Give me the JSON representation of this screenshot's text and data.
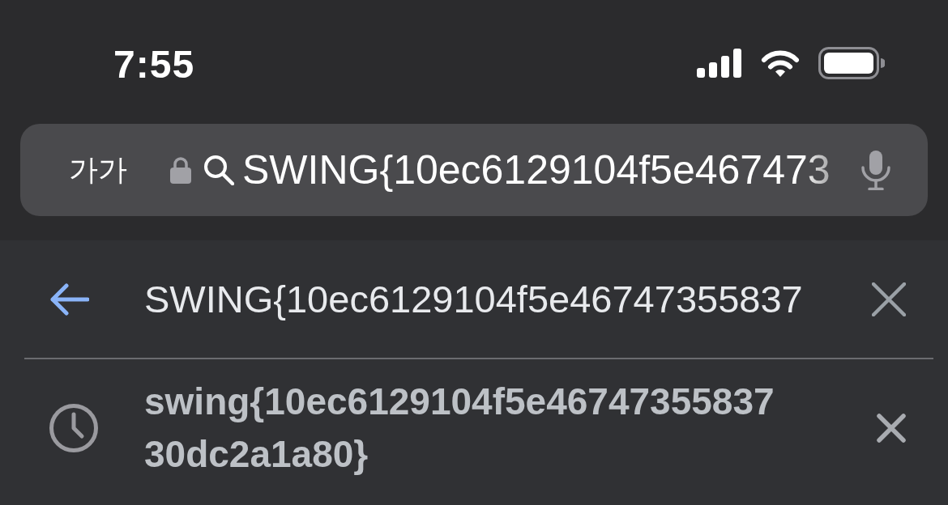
{
  "status_bar": {
    "time": "7:55"
  },
  "address_bar": {
    "text_size_button": "가가",
    "url": "SWING{10ec6129104f5e467473"
  },
  "suggestions": [
    {
      "kind": "query",
      "text": "SWING{10ec6129104f5e46747355837"
    },
    {
      "kind": "history",
      "text": "swing{10ec6129104f5e4674735583730dc2a1a80}"
    }
  ]
}
